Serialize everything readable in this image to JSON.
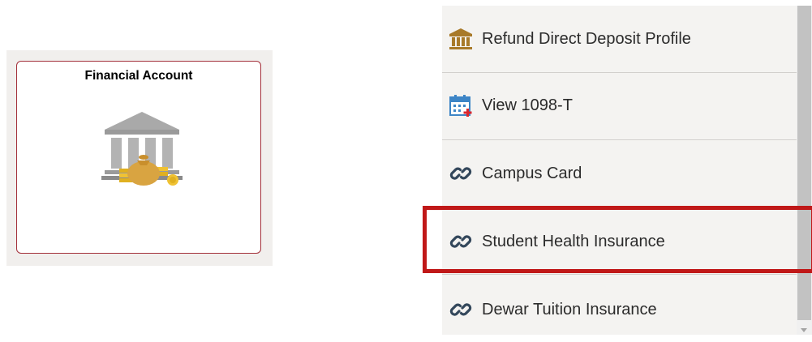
{
  "tile": {
    "title": "Financial Account",
    "icon": "bank-moneybag-icon"
  },
  "menu": {
    "items": [
      {
        "label": "Refund Direct Deposit Profile",
        "icon": "bank-icon"
      },
      {
        "label": "View 1098-T",
        "icon": "calendar-add-icon"
      },
      {
        "label": "Campus Card",
        "icon": "link-icon"
      },
      {
        "label": "Student Health Insurance",
        "icon": "link-icon",
        "highlighted": true
      },
      {
        "label": "Dewar Tuition Insurance",
        "icon": "link-icon"
      }
    ]
  },
  "colors": {
    "tile_border": "#a3303a",
    "highlight_border": "#c01818",
    "bank_icon": "#a87a2a",
    "calendar_icon": "#3d85c6",
    "link_icon": "#33475b",
    "menu_bg": "#f4f3f1"
  }
}
